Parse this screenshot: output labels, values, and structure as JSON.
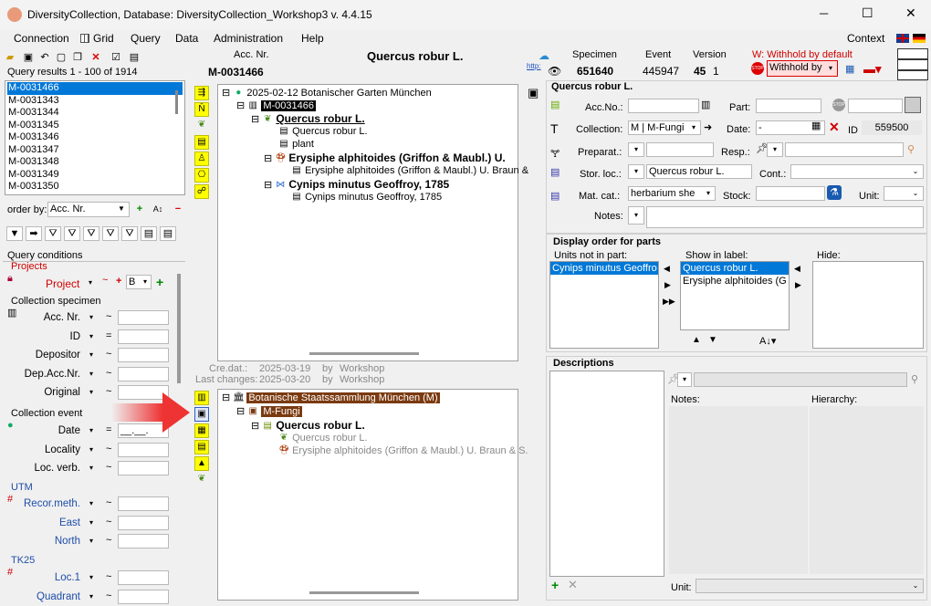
{
  "window": {
    "title": "DiversityCollection,  Database: DiversityCollection_Workshop3    v. 4.4.15",
    "minimize": "─",
    "maximize": "☐",
    "close": "✕"
  },
  "menu": {
    "items": [
      "Connection",
      "Grid",
      "Query",
      "Data",
      "Administration",
      "Help"
    ],
    "context": "Context"
  },
  "query": {
    "results_label": "Query results   1 - 100 of 1914",
    "results": [
      "M-0031466",
      "M-0031343",
      "M-0031344",
      "M-0031345",
      "M-0031346",
      "M-0031347",
      "M-0031348",
      "M-0031349",
      "M-0031350"
    ],
    "order_by_label": "order by:",
    "order_by_value": "Acc. Nr."
  },
  "conditions": {
    "title": "Query conditions",
    "projects_header": "Projects",
    "project_label": "Project",
    "project_op1": "~",
    "project_op2": "+",
    "project_value": "B",
    "collection_specimen_header": "Collection specimen",
    "specimen_fields": [
      {
        "label": "Acc. Nr.",
        "op": "~"
      },
      {
        "label": "ID",
        "op": "="
      },
      {
        "label": "Depositor",
        "op": "~"
      },
      {
        "label": "Dep.Acc.Nr.",
        "op": "~"
      },
      {
        "label": "Original",
        "op": "~"
      }
    ],
    "collection_event_header": "Collection event",
    "event_fields": [
      {
        "label": "Date",
        "op": "="
      },
      {
        "label": "Locality",
        "op": "~"
      },
      {
        "label": "Loc. verb.",
        "op": "~"
      }
    ],
    "utm_header": "UTM",
    "utm_fields": [
      {
        "label": "Recor.meth.",
        "op": "~"
      },
      {
        "label": "East",
        "op": "~"
      },
      {
        "label": "North",
        "op": "~"
      }
    ],
    "tk25_header": "TK25",
    "tk25_fields": [
      {
        "label": "Loc.1",
        "op": "~"
      },
      {
        "label": "Quadrant",
        "op": "~"
      }
    ],
    "date_placeholder": "__.__."
  },
  "header": {
    "acc_nr_label": "Acc. Nr.",
    "acc_nr_value": "M-0031466",
    "species_title": "Quercus robur L."
  },
  "tree1": {
    "date_line": "2025-02-12 Botanischer Garten München",
    "specimen": "M-0031466",
    "species1": "Quercus robur L.",
    "item_q": "Quercus robur L.",
    "item_plant": "plant",
    "species2": "Erysiphe alphitoides (Griffon & Maubl.) U.",
    "item_e": "Erysiphe alphitoides (Griffon & Maubl.) U. Braun &",
    "species3": "Cynips minutus Geoffroy, 1785",
    "item_c": "Cynips minutus Geoffroy, 1785"
  },
  "audit": {
    "cre_label": "Cre.dat.:",
    "cre_date": "2025-03-19",
    "cre_by": "by",
    "cre_user": "Workshop",
    "last_label": "Last changes:",
    "last_date": "2025-03-20",
    "last_by": "by",
    "last_user": "Workshop"
  },
  "tree2": {
    "collection": "Botanische Staatssammlung München (M)",
    "fungi": "M-Fungi",
    "species": "Quercus robur L.",
    "item_q": "Quercus robur L.",
    "item_e": "Erysiphe alphitoides (Griffon & Maubl.) U. Braun & S."
  },
  "top": {
    "http": "http:",
    "specimen_label": "Specimen",
    "specimen_value": "651640",
    "event_label": "Event",
    "event_value": "445947",
    "version_label": "Version",
    "version_value": "45",
    "version_sub": "1",
    "withhold_label": "W: Withhold by default",
    "withhold_value": "Withhold by"
  },
  "detail": {
    "title": "Quercus robur L.",
    "accno_label": "Acc.No.:",
    "part_label": "Part:",
    "collection_label": "Collection:",
    "collection_value": "M | M-Fungi",
    "date_label": "Date:",
    "date_value": "-",
    "id_label": "ID",
    "id_value": "559500",
    "preparat_label": "Preparat.:",
    "resp_label": "Resp.:",
    "storloc_label": "Stor. loc.:",
    "storloc_value": "Quercus robur L.",
    "cont_label": "Cont.:",
    "matcat_label": "Mat. cat.:",
    "matcat_value": "herbarium she",
    "stock_label": "Stock:",
    "unit_label": "Unit:",
    "notes_label": "Notes:"
  },
  "display": {
    "title": "Display order for parts",
    "not_in_part_label": "Units not in part:",
    "not_in_part": [
      "Cynips minutus Geoffro"
    ],
    "show_label": "Show in label:",
    "show": [
      "Quercus robur L.",
      "Erysiphe alphitoides (G"
    ],
    "hide_label": "Hide:"
  },
  "descriptions": {
    "title": "Descriptions",
    "notes_label": "Notes:",
    "hierarchy_label": "Hierarchy:",
    "unit_label": "Unit:"
  }
}
